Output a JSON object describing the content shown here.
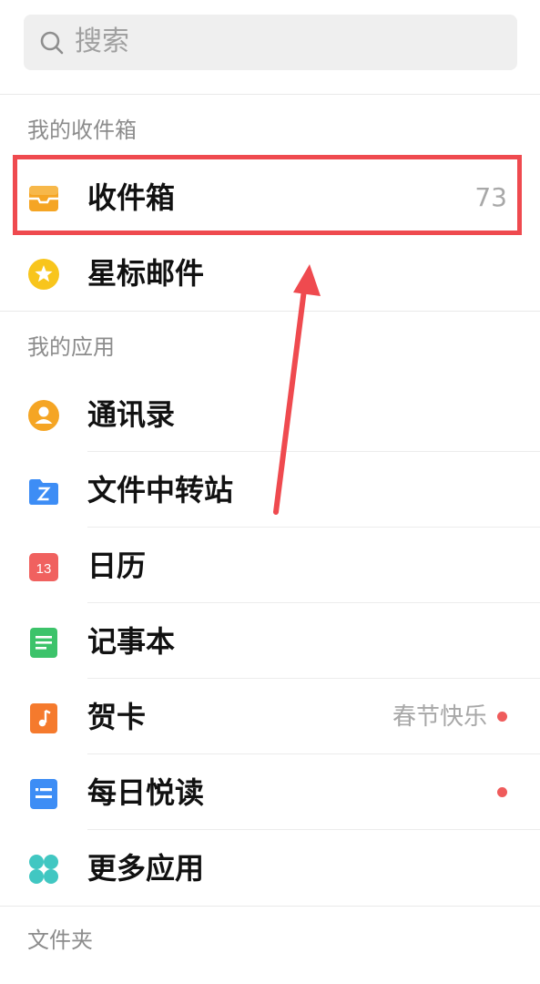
{
  "search": {
    "placeholder": "搜索"
  },
  "sections": {
    "mailboxes": "我的收件箱",
    "apps": "我的应用",
    "folders": "文件夹"
  },
  "mailboxes": [
    {
      "label": "收件箱",
      "count": "73",
      "icon": "inbox-tray-icon"
    },
    {
      "label": "星标邮件",
      "icon": "star-icon"
    }
  ],
  "apps": [
    {
      "label": "通讯录",
      "icon": "contacts-person-icon"
    },
    {
      "label": "文件中转站",
      "icon": "folder-transfer-icon"
    },
    {
      "label": "日历",
      "icon": "calendar-icon",
      "icon_text": "13"
    },
    {
      "label": "记事本",
      "icon": "notepad-icon"
    },
    {
      "label": "贺卡",
      "icon": "greeting-card-music-icon",
      "subtext": "春节快乐",
      "has_dot": true
    },
    {
      "label": "每日悦读",
      "icon": "daily-reading-icon",
      "has_dot": true
    },
    {
      "label": "更多应用",
      "icon": "more-apps-grid-icon"
    }
  ],
  "colors": {
    "highlight": "#ef4a4f",
    "inbox_icon": "#f5a524",
    "star_icon": "#f8c51c",
    "contacts_icon": "#f5a524",
    "folder_icon": "#3d8df5",
    "calendar_icon": "#f0615f",
    "notepad_icon": "#3cc36a",
    "card_icon": "#f57a2d",
    "reading_icon": "#3d8df5",
    "more_icon": "#41c7c2",
    "dot": "#ef5b5b"
  }
}
